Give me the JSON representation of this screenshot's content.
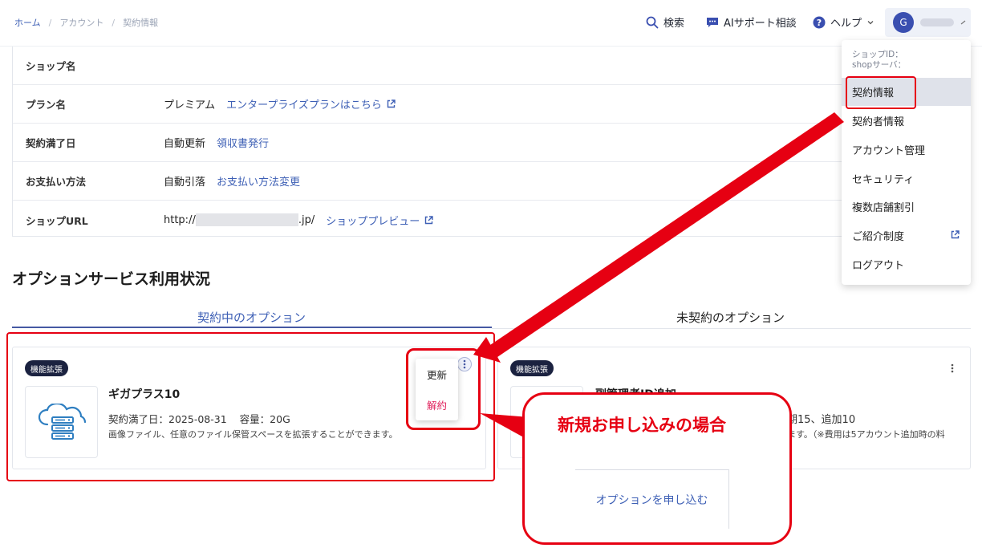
{
  "breadcrumb": {
    "items": [
      "ホーム",
      "アカウント",
      "契約情報"
    ],
    "separator": "/"
  },
  "header": {
    "search_label": "検索",
    "ai_label": "AIサポート相談",
    "help_label": "ヘルプ",
    "user_initial": "G"
  },
  "user_menu": {
    "shop_id_label": "ショップID：",
    "shop_server_label": "shopサーバ：",
    "items": [
      {
        "label": "契約情報",
        "active": true
      },
      {
        "label": "契約者情報"
      },
      {
        "label": "アカウント管理"
      },
      {
        "label": "セキュリティ"
      },
      {
        "label": "複数店舗割引"
      },
      {
        "label": "ご紹介制度",
        "external": true
      },
      {
        "label": "ログアウト"
      }
    ]
  },
  "info_table": {
    "rows": [
      {
        "label": "ショップ名"
      },
      {
        "label": "プラン名",
        "value": "プレミアム",
        "link": "エンタープライズプランはこちら"
      },
      {
        "label": "契約満了日",
        "value": "自動更新",
        "link": "領収書発行"
      },
      {
        "label": "お支払い方法",
        "value": "自動引落",
        "link": "お支払い方法変更"
      },
      {
        "label": "ショップURL",
        "value_prefix": "http://",
        "value_suffix": ".jp/",
        "link": "ショッププレビュー"
      }
    ]
  },
  "options": {
    "section_title": "オプションサービス利用状況",
    "tabs": [
      {
        "label": "契約中のオプション",
        "active": true
      },
      {
        "label": "未契約のオプション",
        "active": false
      }
    ],
    "cards": [
      {
        "badge": "機能拡張",
        "title": "ギガプラス10",
        "expiry_label": "契約満了日：",
        "expiry": "2025-08-31",
        "capacity_label": "容量：",
        "capacity": "20G",
        "description": "画像ファイル、任意のファイル保管スペースを拡張することができます。"
      },
      {
        "badge": "機能拡張",
        "title": "副管理者ID追加",
        "meta_partial": "期15、追加10",
        "desc_partial": "ます。（※費用は5アカウント追加時の料"
      }
    ],
    "card_menu": {
      "renew": "更新",
      "cancel": "解約"
    }
  },
  "annotation": {
    "callout_text": "新規お申し込みの場合",
    "apply_button": "オプションを申し込む",
    "color": "#e60012"
  },
  "colors": {
    "accent": "#3d5fb5",
    "badge": "#1b2240",
    "danger": "#e0245e",
    "active_menu": "#dfe2ea"
  }
}
